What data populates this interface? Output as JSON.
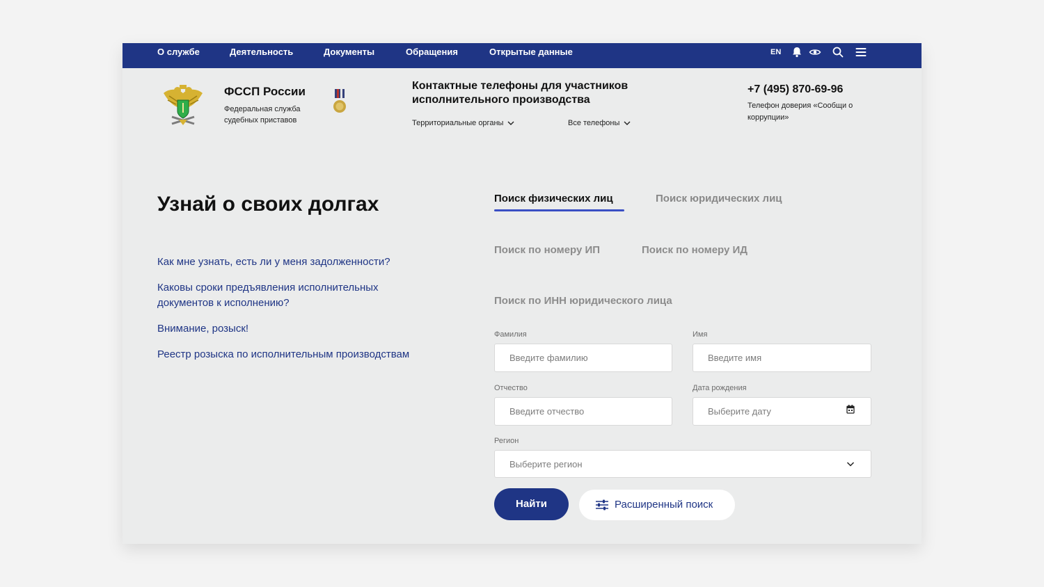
{
  "topnav": {
    "items": [
      "О службе",
      "Деятельность",
      "Документы",
      "Обращения",
      "Открытые данные"
    ],
    "lang": "EN"
  },
  "header": {
    "org_title": "ФССП России",
    "org_subtitle": "Федеральная служба судебных приставов",
    "contacts_title": "Контактные телефоны для участников исполнительного производства",
    "territorial_label": "Территориальные органы",
    "all_phones_label": "Все телефоны",
    "phone": "+7 (495) 870-69-96",
    "phone_note": "Телефон доверия «Сообщи о коррупции»"
  },
  "main": {
    "title": "Узнай о своих долгах",
    "faq": [
      "Как мне узнать, есть ли у меня задолженности?",
      "Каковы сроки предъявления исполнительных документов к исполнению?",
      "Внимание, розыск!",
      "Реестр розыска по исполнительным производствам"
    ]
  },
  "search": {
    "tabs": [
      "Поиск физических лиц",
      "Поиск юридических лиц"
    ],
    "active_tab": "Поиск физических лиц",
    "subtabs": [
      "Поиск по номеру ИП",
      "Поиск по номеру ИД",
      "Поиск по ИНН юридического лица"
    ],
    "form": {
      "lastname_label": "Фамилия",
      "lastname_placeholder": "Введите фамилию",
      "firstname_label": "Имя",
      "firstname_placeholder": "Введите имя",
      "patronymic_label": "Отчество",
      "patronymic_placeholder": "Введите отчество",
      "birthdate_label": "Дата рождения",
      "birthdate_placeholder": "Выберите дату",
      "region_label": "Регион",
      "region_placeholder": "Выберите регион"
    },
    "find_button": "Найти",
    "advanced_button": "Расширенный поиск"
  },
  "colors": {
    "primary": "#1f3585",
    "tab_accent": "#3a4fc4",
    "page_bg": "#ebecec"
  },
  "icons": [
    "bell-icon",
    "eye-icon",
    "search-icon",
    "menu-icon",
    "calendar-icon",
    "chevron-down-icon",
    "sliders-icon",
    "emblem-icon",
    "medal-icon"
  ]
}
